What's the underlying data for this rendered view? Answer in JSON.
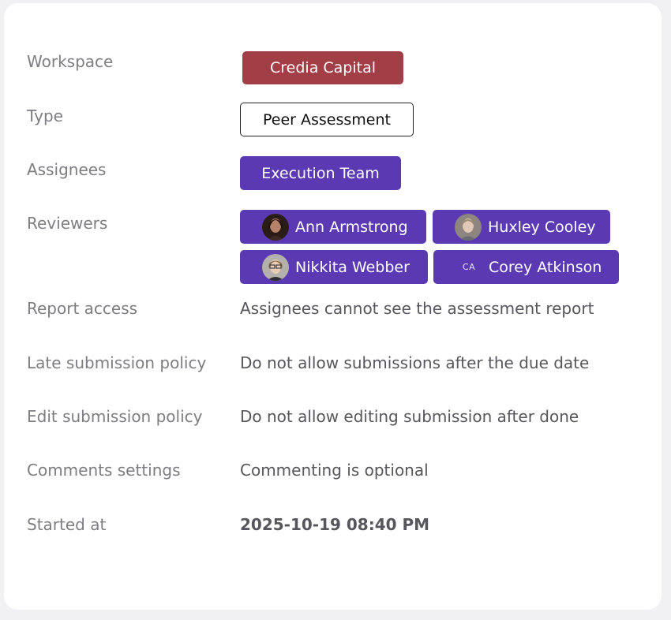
{
  "details": {
    "workspace": {
      "label": "Workspace",
      "value": "Credia Capital"
    },
    "type": {
      "label": "Type",
      "value": "Peer Assessment"
    },
    "assignees": {
      "label": "Assignees",
      "value": "Execution Team"
    },
    "reviewers": {
      "label": "Reviewers",
      "people": [
        {
          "name": "Ann Armstrong",
          "avatar": "photo"
        },
        {
          "name": "Huxley Cooley",
          "avatar": "photo"
        },
        {
          "name": "Nikkita Webber",
          "avatar": "photo"
        },
        {
          "name": "Corey Atkinson",
          "avatar": "CA"
        }
      ]
    },
    "report_access": {
      "label": "Report access",
      "value": "Assignees cannot see the assessment report"
    },
    "late_submission": {
      "label": "Late submission policy",
      "value": "Do not allow submissions after the due date"
    },
    "edit_submission": {
      "label": "Edit submission policy",
      "value": "Do not allow editing submission after done"
    },
    "comments": {
      "label": "Comments settings",
      "value": "Commenting is optional"
    },
    "started_at": {
      "label": "Started at",
      "value": "2025-10-19 08:40 PM"
    }
  },
  "colors": {
    "workspace_chip": "#a23e45",
    "purple_chip": "#5b39b3",
    "label_text": "#7d7d82",
    "value_text": "#56565c"
  }
}
